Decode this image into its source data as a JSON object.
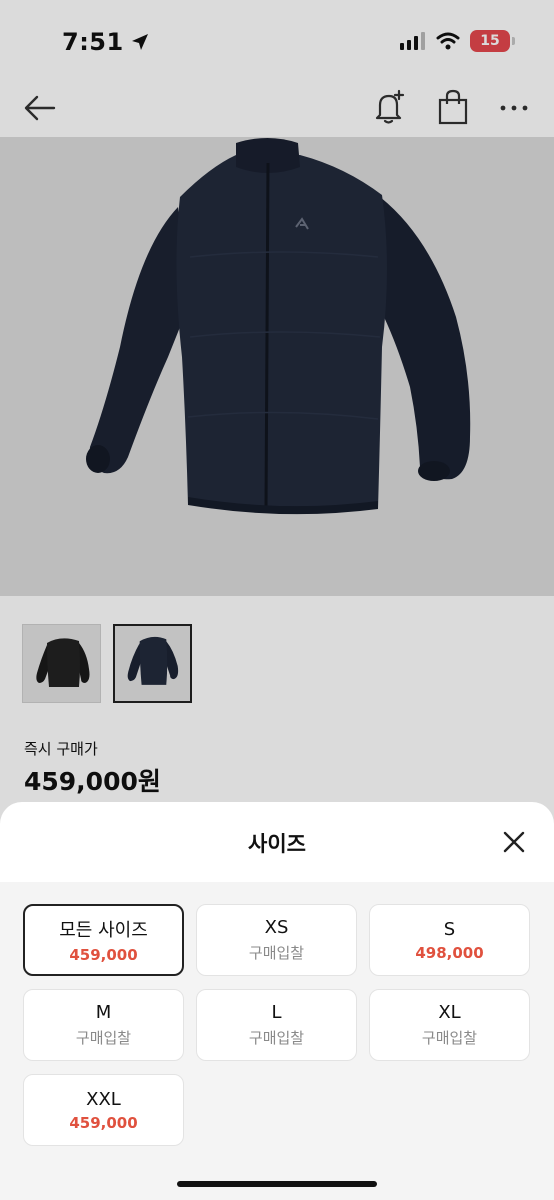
{
  "status_bar": {
    "time": "7:51",
    "battery": "15"
  },
  "nav": {
    "back_icon": "back-arrow-icon",
    "bell_icon": "bell-plus-icon",
    "bag_icon": "shopping-bag-icon",
    "more_icon": "more-icon"
  },
  "product": {
    "thumbnails": [
      "black-jacket",
      "navy-jacket"
    ],
    "price_label": "즉시 구매가",
    "price": "459,000원"
  },
  "sheet": {
    "title": "사이즈",
    "close_icon": "close-icon",
    "sizes": [
      {
        "name": "모든 사이즈",
        "sub": "459,000",
        "is_price": true,
        "selected": true
      },
      {
        "name": "XS",
        "sub": "구매입찰",
        "is_price": false,
        "selected": false
      },
      {
        "name": "S",
        "sub": "498,000",
        "is_price": true,
        "selected": false
      },
      {
        "name": "M",
        "sub": "구매입찰",
        "is_price": false,
        "selected": false
      },
      {
        "name": "L",
        "sub": "구매입찰",
        "is_price": false,
        "selected": false
      },
      {
        "name": "XL",
        "sub": "구매입찰",
        "is_price": false,
        "selected": false
      },
      {
        "name": "XXL",
        "sub": "459,000",
        "is_price": true,
        "selected": false
      }
    ]
  },
  "colors": {
    "price_red": "#e0513e",
    "jacket_navy": "#1f2637",
    "jacket_black": "#1a1a1a"
  }
}
